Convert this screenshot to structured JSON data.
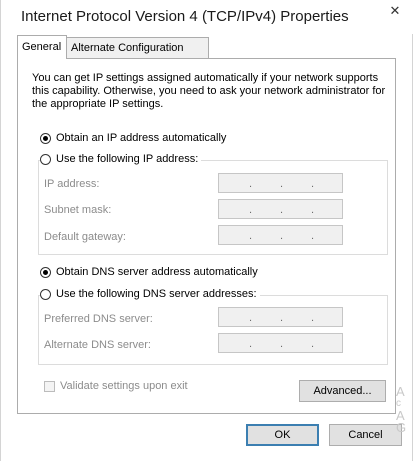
{
  "window": {
    "title": "Internet Protocol Version 4 (TCP/IPv4) Properties",
    "close_symbol": "✕"
  },
  "tabs": [
    {
      "label": "General",
      "active": true
    },
    {
      "label": "Alternate Configuration",
      "active": false
    }
  ],
  "intro_text": "You can get IP settings assigned automatically if your network supports this capability. Otherwise, you need to ask your network administrator for the appropriate IP settings.",
  "ip_settings": {
    "auto_label": "Obtain an IP address automatically",
    "auto_selected": true,
    "manual_label": "Use the following IP address:",
    "manual_selected": false,
    "fields": [
      {
        "label": "IP address:",
        "value": ". . ."
      },
      {
        "label": "Subnet mask:",
        "value": ". . ."
      },
      {
        "label": "Default gateway:",
        "value": ". . ."
      }
    ]
  },
  "dns_settings": {
    "auto_label": "Obtain DNS server address automatically",
    "auto_selected": true,
    "manual_label": "Use the following DNS server addresses:",
    "manual_selected": false,
    "fields": [
      {
        "label": "Preferred DNS server:",
        "value": ". . ."
      },
      {
        "label": "Alternate DNS server:",
        "value": ". . ."
      }
    ]
  },
  "validate": {
    "label": "Validate settings upon exit",
    "checked": false,
    "enabled": false
  },
  "buttons": {
    "advanced": "Advanced...",
    "ok": "OK",
    "cancel": "Cancel"
  },
  "colors": {
    "disabled_text": "#8c8c8c",
    "field_background": "#f0f0f0",
    "default_button_border": "#3c7fb1"
  }
}
